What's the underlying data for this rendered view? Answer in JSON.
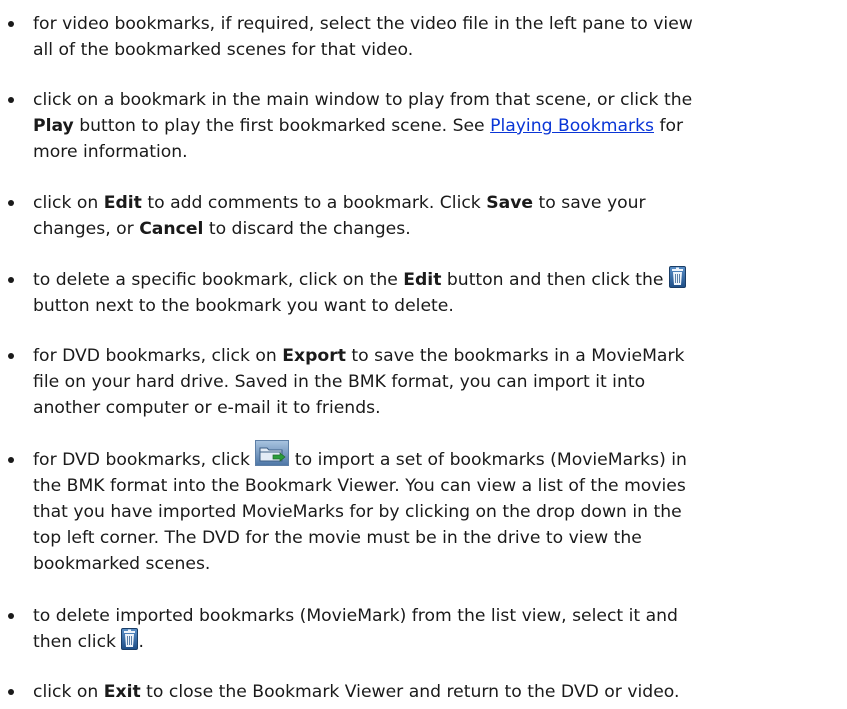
{
  "items": [
    {
      "line1": "for video bookmarks, if required, select the video file in the left pane to view",
      "line2": "all of the bookmarked scenes for that video."
    },
    {
      "line1": "click on a bookmark in the main window to play from that scene, or click the",
      "play_label": "Play",
      "line2_a": " button to play the first bookmarked scene. See ",
      "link": "Playing Bookmarks",
      "line2_b": " for",
      "line3": "more information."
    },
    {
      "line1_a": "click on ",
      "edit_label": "Edit",
      "line1_b": " to add comments to a bookmark. Click ",
      "save_label": "Save",
      "line1_c": " to save your",
      "line2_a": "changes, or ",
      "cancel_label": "Cancel",
      "line2_b": " to discard the changes."
    },
    {
      "line1_a": "to delete a specific bookmark, click on the ",
      "edit_label": "Edit",
      "line1_b": " button and then click the ",
      "line2": "button next to the bookmark you want to delete."
    },
    {
      "line1_a": "for DVD bookmarks, click on ",
      "export_label": "Export",
      "line1_b": " to save the bookmarks in a MovieMark",
      "line2": "file on your hard drive. Saved in the BMK format, you can import it into",
      "line3": "another computer or e-mail it to friends."
    },
    {
      "line1_a": "for DVD bookmarks, click ",
      "line1_b": " to import a set of bookmarks (MovieMarks) in",
      "line2": "the BMK format into the Bookmark Viewer. You can view a list of the movies",
      "line3": "that you have imported MovieMarks for by clicking on the drop down in the",
      "line4": "top left corner. The DVD for the movie must be in the drive to view the",
      "line5": "bookmarked scenes."
    },
    {
      "line1": "to delete imported bookmarks (MovieMark) from the list view, select it and",
      "line2_a": "then click ",
      "line2_b": "."
    },
    {
      "line1_a": "click on ",
      "exit_label": "Exit",
      "line1_b": " to close the Bookmark Viewer and return to the DVD or video."
    }
  ],
  "icons": {
    "trash": "trash-can-icon",
    "import": "import-folder-icon"
  },
  "colors": {
    "text": "#1a1a1a",
    "link": "#0a35d6"
  }
}
